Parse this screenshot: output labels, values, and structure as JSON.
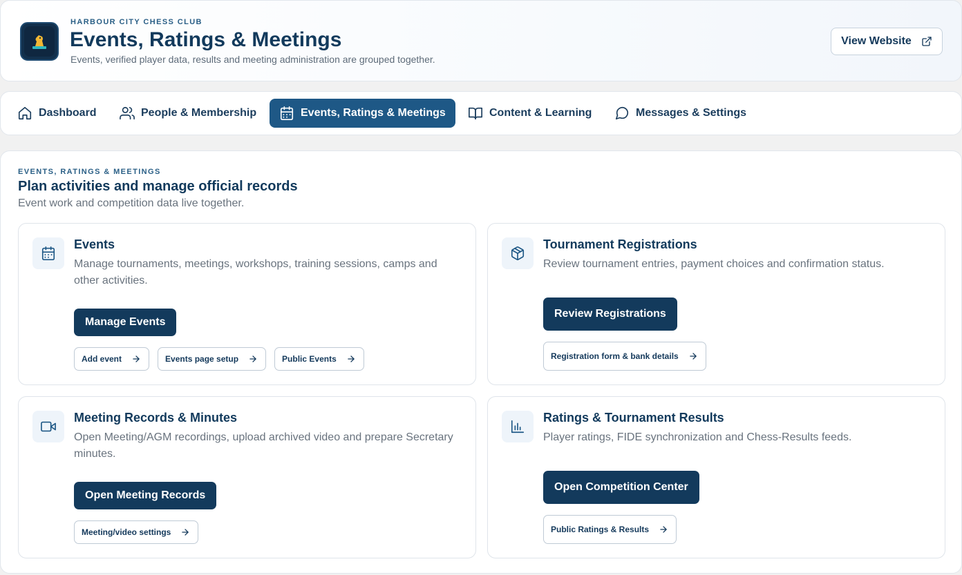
{
  "colors": {
    "primary": "#133a5c",
    "active_tab": "#1e5886",
    "eyebrow": "#2a5f86",
    "muted_text": "#69737e",
    "background": "#f1f1f1"
  },
  "header": {
    "club_name": "HARBOUR CITY CHESS CLUB",
    "title": "Events, Ratings & Meetings",
    "subtitle": "Events, verified player data, results and meeting administration are grouped together.",
    "logo_icon": "chess-piece-icon",
    "view_website": {
      "label": "View Website",
      "icon": "external-link-icon"
    }
  },
  "nav": {
    "tabs": [
      {
        "label": "Dashboard",
        "icon": "home-icon",
        "active": false
      },
      {
        "label": "People & Membership",
        "icon": "users-icon",
        "active": false
      },
      {
        "label": "Events, Ratings & Meetings",
        "icon": "calendar-icon",
        "active": true
      },
      {
        "label": "Content & Learning",
        "icon": "book-icon",
        "active": false
      },
      {
        "label": "Messages & Settings",
        "icon": "message-icon",
        "active": false
      }
    ]
  },
  "section": {
    "eyebrow": "EVENTS, RATINGS & MEETINGS",
    "title": "Plan activities and manage official records",
    "subtitle": "Event work and competition data live together."
  },
  "cards": [
    {
      "title": "Events",
      "icon": "calendar-icon",
      "description": "Manage tournaments, meetings, workshops, training sessions, camps and other activities.",
      "primary": "Manage Events",
      "links": [
        "Add event",
        "Events page setup",
        "Public Events"
      ]
    },
    {
      "title": "Tournament Registrations",
      "icon": "package-icon",
      "description": "Review tournament entries, payment choices and confirmation status.",
      "primary": "Review Registrations",
      "links": [
        "Registration form & bank details"
      ]
    },
    {
      "title": "Meeting Records & Minutes",
      "icon": "video-icon",
      "description": "Open Meeting/AGM recordings, upload archived video and prepare Secretary minutes.",
      "primary": "Open Meeting Records",
      "links": [
        "Meeting/video settings"
      ]
    },
    {
      "title": "Ratings & Tournament Results",
      "icon": "bar-chart-icon",
      "description": "Player ratings, FIDE synchronization and Chess-Results feeds.",
      "primary": "Open Competition Center",
      "links": [
        "Public Ratings & Results"
      ]
    }
  ]
}
